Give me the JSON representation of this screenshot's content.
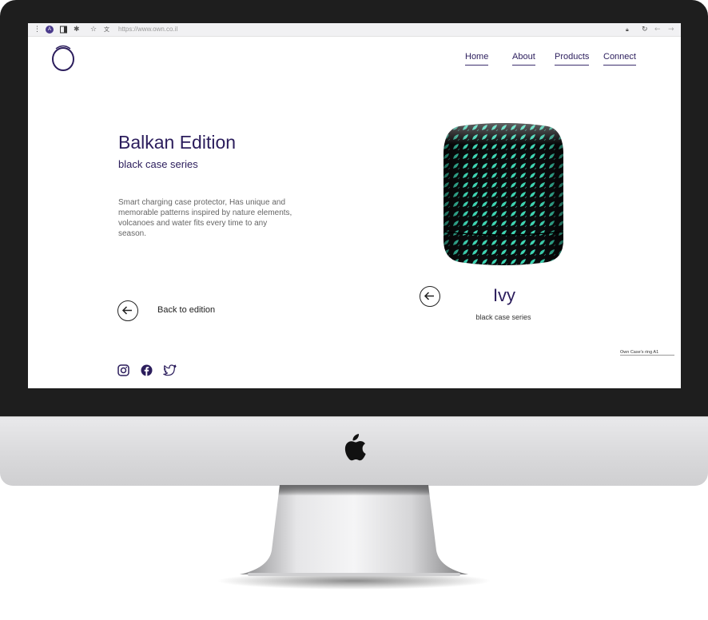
{
  "browser": {
    "url": "https://www.own.co.il",
    "avatar_letter": "A",
    "icons": [
      "menu-dots-icon",
      "avatar-icon",
      "sidebar-icon",
      "extensions-icon",
      "star-icon",
      "translate-icon",
      "lock-icon",
      "reload-icon",
      "back-icon",
      "forward-icon"
    ]
  },
  "nav": {
    "items": [
      {
        "label": "Home"
      },
      {
        "label": "About"
      },
      {
        "label": "Products"
      },
      {
        "label": "Connect"
      }
    ]
  },
  "hero": {
    "title": "Balkan Edition",
    "subtitle": "black case series",
    "description": "Smart charging case protector, Has unique and memorable patterns inspired by nature elements, volcanoes and water fits every time to any season.",
    "back_label": "Back to edition"
  },
  "product": {
    "name": "Ivy",
    "series": "black case series",
    "caption": "Own Case's ring A1"
  },
  "social": {
    "icons": [
      "instagram-icon",
      "facebook-icon",
      "twitter-icon"
    ]
  },
  "colors": {
    "brand": "#2b1d5c",
    "pattern_accent": "#3fd6b4",
    "case_body": "#0a0a0c",
    "bezel": "#1e1e1e"
  }
}
